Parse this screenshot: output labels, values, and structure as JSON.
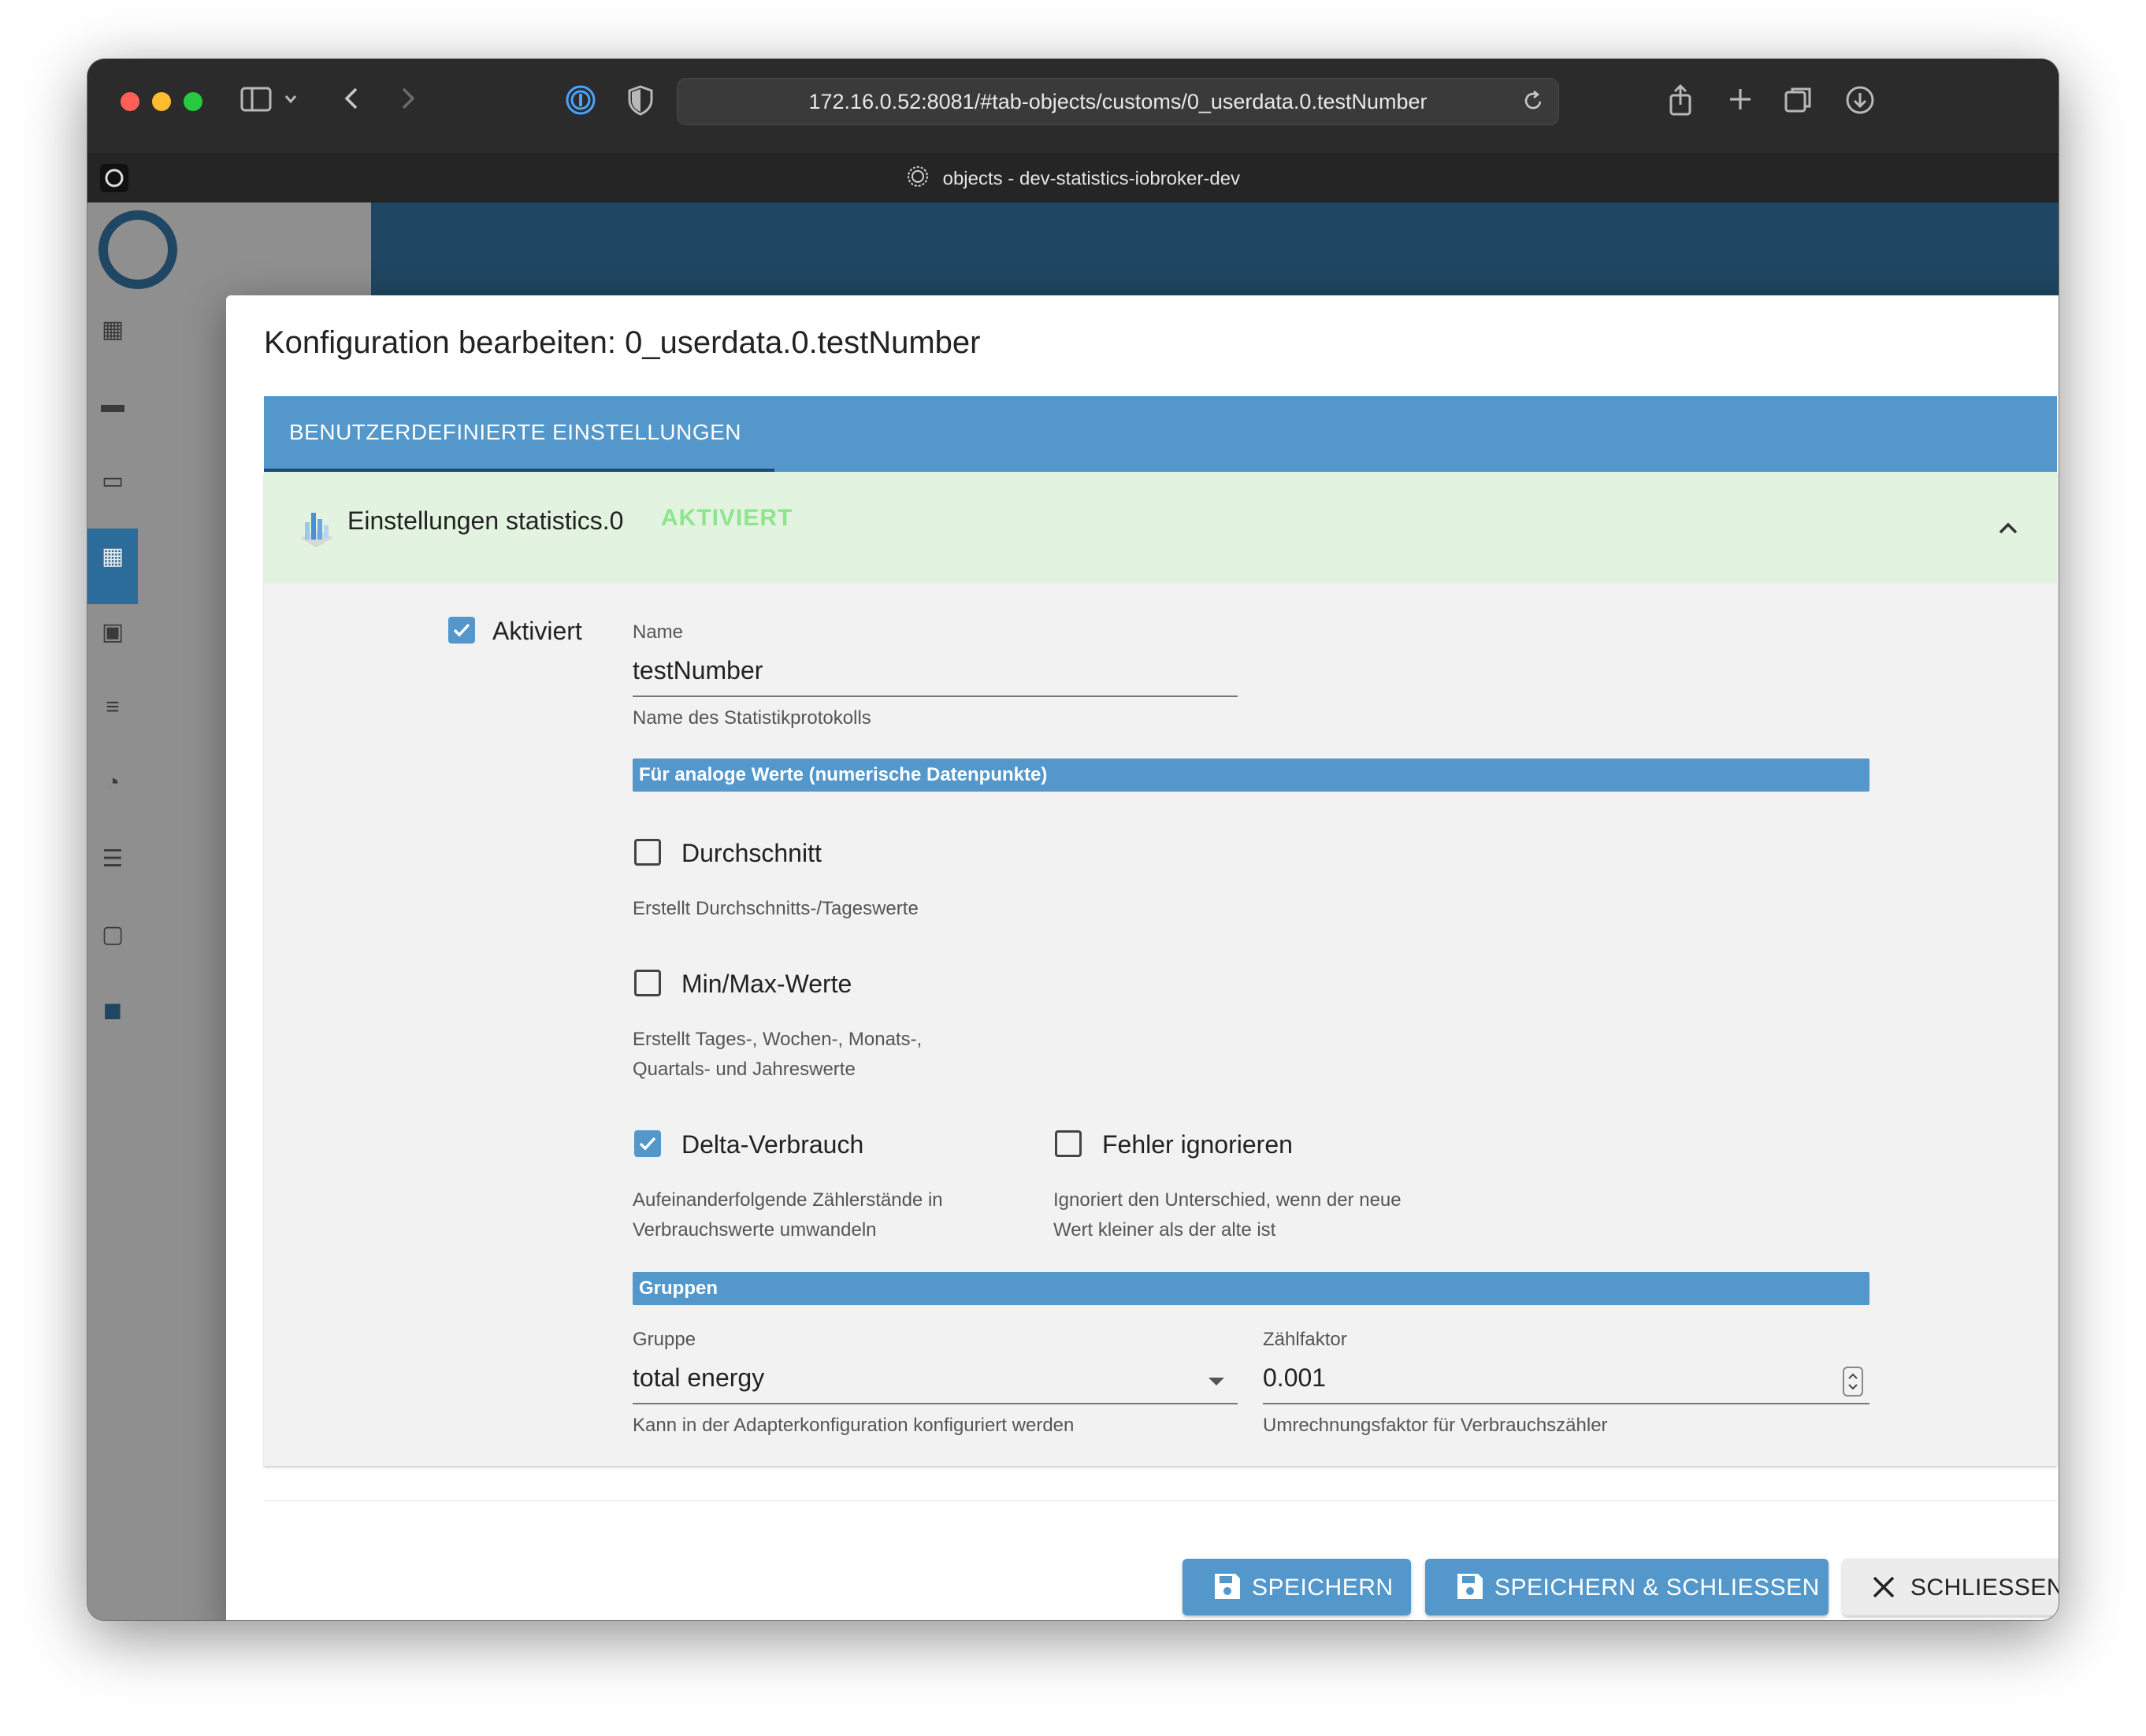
{
  "browser": {
    "url": "172.16.0.52:8081/#tab-objects/customs/0_userdata.0.testNumber",
    "tab_title": "objects - dev-statistics-iobroker-dev"
  },
  "dialog": {
    "title": "Konfiguration bearbeiten: 0_userdata.0.testNumber",
    "tab_label": "BENUTZERDEFINIERTE EINSTELLUNGEN",
    "adapter": {
      "title": "Einstellungen statistics.0",
      "status": "AKTIVIERT"
    },
    "enabled": {
      "label": "Aktiviert",
      "checked": true
    },
    "name_field": {
      "label": "Name",
      "value": "testNumber",
      "helper": "Name des Statistikprotokolls"
    },
    "section_analog": "Für analoge Werte (numerische Datenpunkte)",
    "average": {
      "label": "Durchschnitt",
      "checked": false,
      "helper": "Erstellt Durchschnitts-/Tageswerte"
    },
    "minmax": {
      "label": "Min/Max-Werte",
      "checked": false,
      "helper_line1": "Erstellt Tages-, Wochen-, Monats-,",
      "helper_line2": "Quartals- und Jahreswerte"
    },
    "delta": {
      "label": "Delta-Verbrauch",
      "checked": true,
      "helper_line1": "Aufeinanderfolgende Zählerstände in",
      "helper_line2": "Verbrauchswerte umwandeln"
    },
    "ignore_errors": {
      "label": "Fehler ignorieren",
      "checked": false,
      "helper_line1": "Ignoriert den Unterschied, wenn der neue",
      "helper_line2": "Wert kleiner als der alte ist"
    },
    "section_groups": "Gruppen",
    "group_field": {
      "label": "Gruppe",
      "value": "total energy",
      "helper": "Kann in der Adapterkonfiguration konfiguriert werden"
    },
    "factor_field": {
      "label": "Zählfaktor",
      "value": "0.001",
      "helper": "Umrechnungsfaktor für Verbrauchszähler"
    },
    "buttons": {
      "save": "SPEICHERN",
      "save_close": "SPEICHERN & SCHLIESSEN",
      "close": "SCHLIESSEN"
    }
  },
  "colors": {
    "primary": "#5397cb",
    "panel_header_bg": "#e2f4df",
    "status_green": "#8ee58e",
    "panel_bg": "#f2f2f2"
  }
}
